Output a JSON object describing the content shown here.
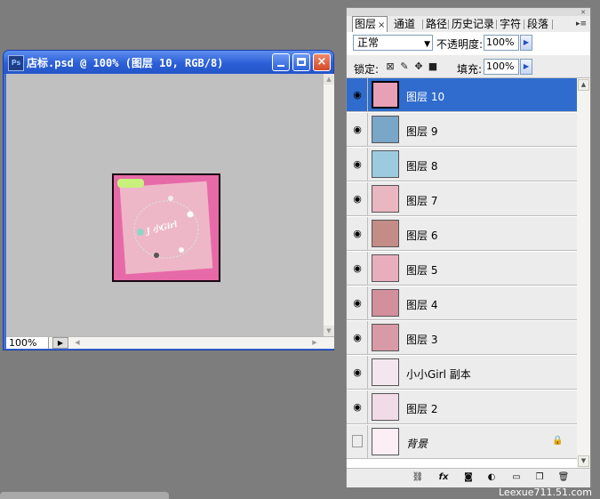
{
  "document": {
    "title": "店标.psd @ 100% (图层 10, RGB/8)",
    "app_icon": "Ps",
    "zoom": "100%",
    "art_text": "J 小Girl",
    "controls": {
      "minimize": "minimize-icon",
      "maximize": "maximize-icon",
      "close": "×"
    }
  },
  "panel": {
    "tabs": [
      {
        "label": "图层",
        "close": "×",
        "active": true
      },
      {
        "label": "通道"
      },
      {
        "label": "路径"
      },
      {
        "label": "历史记录"
      },
      {
        "label": "字符"
      },
      {
        "label": "段落"
      }
    ],
    "blend_mode": "正常",
    "opacity_label": "不透明度:",
    "opacity": "100%",
    "lock_label": "锁定:",
    "fill_label": "填充:",
    "fill": "100%",
    "layers": [
      {
        "name": "图层 10",
        "visible": true,
        "selected": true,
        "thumb": "#e7a0b6"
      },
      {
        "name": "图层 9",
        "visible": true,
        "thumb": "#7aa6c8"
      },
      {
        "name": "图层 8",
        "visible": true,
        "thumb": "#9ccbe0"
      },
      {
        "name": "图层 7",
        "visible": true,
        "thumb": "#e9b6c2"
      },
      {
        "name": "图层 6",
        "visible": true,
        "thumb": "#c48c86"
      },
      {
        "name": "图层 5",
        "visible": true,
        "thumb": "#e9aebd"
      },
      {
        "name": "图层 4",
        "visible": true,
        "thumb": "#d28f9c"
      },
      {
        "name": "图层 3",
        "visible": true,
        "thumb": "#d89aa7"
      },
      {
        "name": "小小Girl 副本",
        "visible": true,
        "thumb": "#f4e6ee"
      },
      {
        "name": "图层 2",
        "visible": true,
        "thumb": "#f1dbe6"
      },
      {
        "name": "背景",
        "visible": false,
        "locked": true,
        "italic": true,
        "thumb": "#fbeef4"
      }
    ]
  },
  "watermark": "Leexue711.51.com"
}
